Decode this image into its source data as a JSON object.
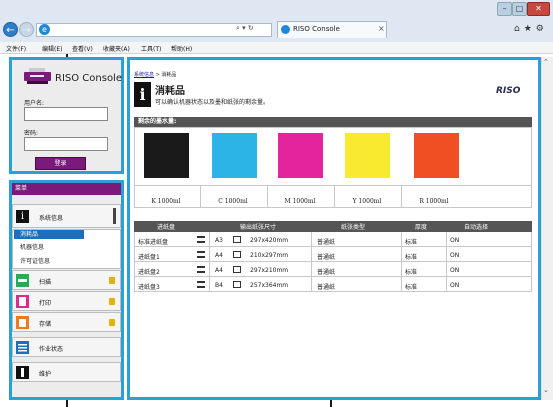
{
  "browser": {
    "address_search": "⌕ ▾ ↻",
    "tab_title": "RISO Console",
    "tab_close": "×",
    "win_min": "–",
    "win_max": "□",
    "win_close": "✕",
    "toolbar_icons": "⌂★⚙",
    "menu": [
      "文件(F)",
      "编辑(E)",
      "查看(V)",
      "收藏夹(A)",
      "工具(T)",
      "帮助(H)"
    ]
  },
  "login": {
    "logo_text": "RISO Console",
    "username_label": "用户名:",
    "password_label": "密码:",
    "login_button": "登录"
  },
  "menu": {
    "header": "菜单",
    "items": [
      {
        "label": "系统信息",
        "icon": "info-icon",
        "locked": false
      },
      {
        "label": "扫描",
        "icon": "scan-icon",
        "locked": true
      },
      {
        "label": "打印",
        "icon": "print-icon",
        "locked": true
      },
      {
        "label": "存储",
        "icon": "storage-icon",
        "locked": true
      },
      {
        "label": "作业状态",
        "icon": "job-status-icon",
        "locked": false
      },
      {
        "label": "维护",
        "icon": "maintenance-icon",
        "locked": false
      }
    ],
    "submenu": [
      "消耗品",
      "机器信息",
      "许可证信息"
    ]
  },
  "main": {
    "breadcrumb_link": "系统信息",
    "breadcrumb_sep": " > ",
    "breadcrumb_current": "消耗品",
    "info_glyph": "i",
    "title": "消耗品",
    "description": "可以确认机器状态以及墨和纸张的剩余量。",
    "brand": "RISO",
    "ink_header": "剩余的墨水量:",
    "inks": [
      {
        "label": "K 1000ml",
        "color": "#1a1a1a",
        "level": 1.0
      },
      {
        "label": "C 1000ml",
        "color": "#2cb4e6",
        "level": 1.0
      },
      {
        "label": "M 1000ml",
        "color": "#e3259d",
        "level": 1.0
      },
      {
        "label": "Y 1000ml",
        "color": "#f7ea2f",
        "level": 1.0
      },
      {
        "label": "R 1000ml",
        "color": "#f04e23",
        "level": 1.0
      }
    ],
    "tray_headers": [
      "进纸盘",
      "输出纸张尺寸",
      "纸张类型",
      "厚度",
      "自动选择"
    ],
    "trays": [
      {
        "name": "标准进纸盘",
        "size": "A3",
        "dims": "297x420mm",
        "type": "普通纸",
        "thickness": "标准",
        "auto": "ON"
      },
      {
        "name": "进纸盘1",
        "size": "A4",
        "dims": "210x297mm",
        "type": "普通纸",
        "thickness": "标准",
        "auto": "ON"
      },
      {
        "name": "进纸盘2",
        "size": "A4",
        "dims": "297x210mm",
        "type": "普通纸",
        "thickness": "标准",
        "auto": "ON"
      },
      {
        "name": "进纸盘3",
        "size": "B4",
        "dims": "257x364mm",
        "type": "普通纸",
        "thickness": "标准",
        "auto": "ON"
      }
    ]
  },
  "colors": {
    "accent_border": "#2aa0d8",
    "login_button": "#7a1a7a",
    "selected_submenu": "#1d6fbd"
  }
}
